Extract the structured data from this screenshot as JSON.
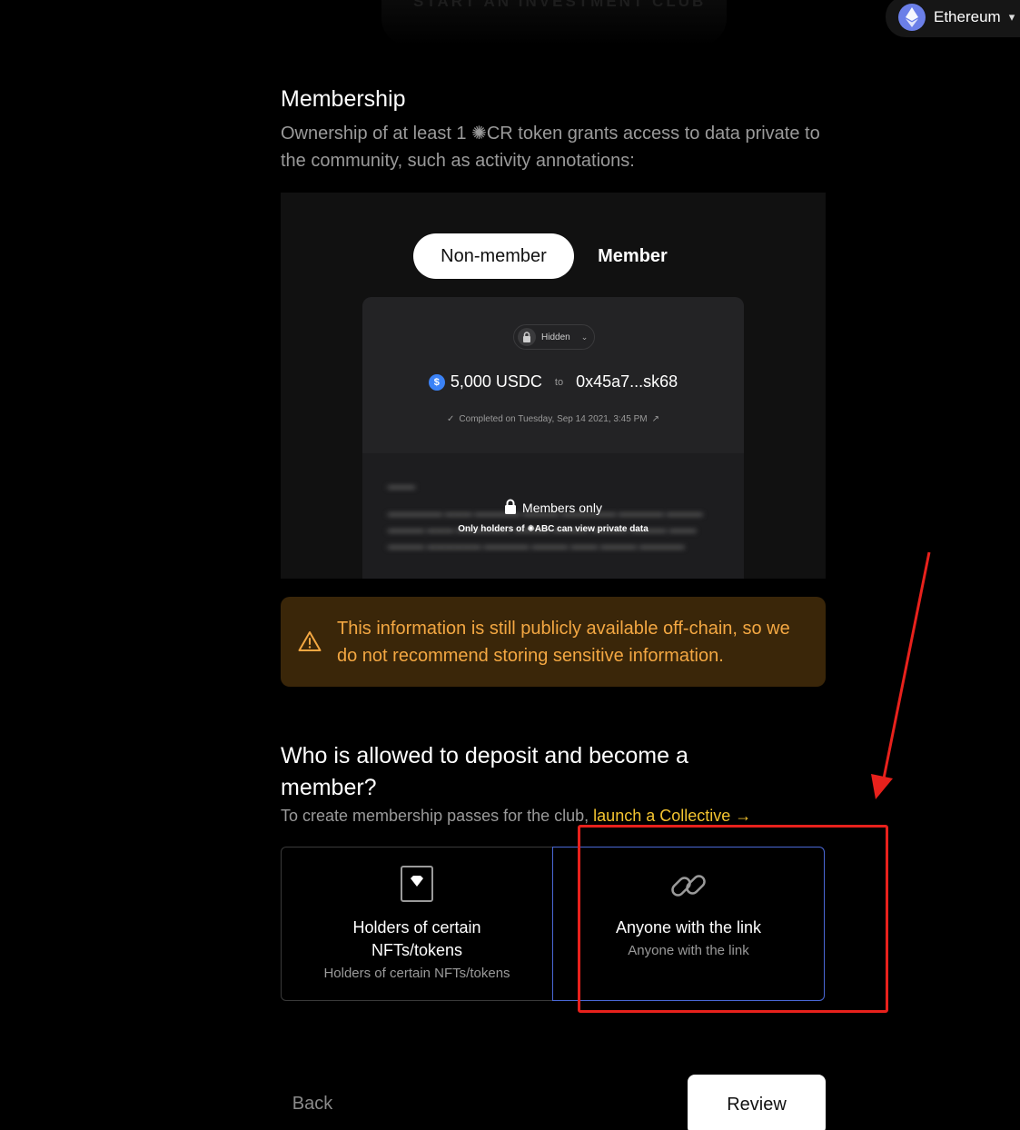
{
  "header": {
    "faded_title": "START AN INVESTMENT CLUB",
    "network": {
      "label": "Ethereum",
      "icon": "ethereum-icon"
    }
  },
  "membership": {
    "title": "Membership",
    "description": "Ownership of at least 1 ✺CR token grants access to data private to the community, such as activity annotations:"
  },
  "preview": {
    "tabs": [
      {
        "label": "Non-member",
        "selected": true
      },
      {
        "label": "Member",
        "selected": false
      }
    ],
    "hidden_label": "Hidden",
    "amount": "5,000 USDC",
    "to_label": "to",
    "address": "0x45a7...sk68",
    "completed": "Completed on Tuesday, Sep 14 2021, 3:45 PM",
    "members_only": "Members only",
    "members_only_sub": "Only holders of ✺ABC can view private data"
  },
  "warning": {
    "text": "This information is still publicly available off-chain, so we do not recommend storing sensitive information.",
    "icon": "warning-icon",
    "color": "#f3a742"
  },
  "deposit": {
    "title": "Who is allowed to deposit and become a member?",
    "subtitle_prefix": "To create membership passes for the club, ",
    "subtitle_link": "launch a Collective →",
    "options": [
      {
        "title": "Holders of certain NFTs/tokens",
        "subtitle": "Holders of certain NFTs/tokens",
        "icon": "nft-diamond-icon",
        "selected": false
      },
      {
        "title": "Anyone with the link",
        "subtitle": "Anyone with the link",
        "icon": "link-icon",
        "selected": true
      }
    ]
  },
  "footer": {
    "back_label": "Back",
    "review_label": "Review"
  },
  "colors": {
    "accent_link": "#f4c430",
    "selected_border": "#4a68d6",
    "annotation_red": "#e8211c"
  }
}
